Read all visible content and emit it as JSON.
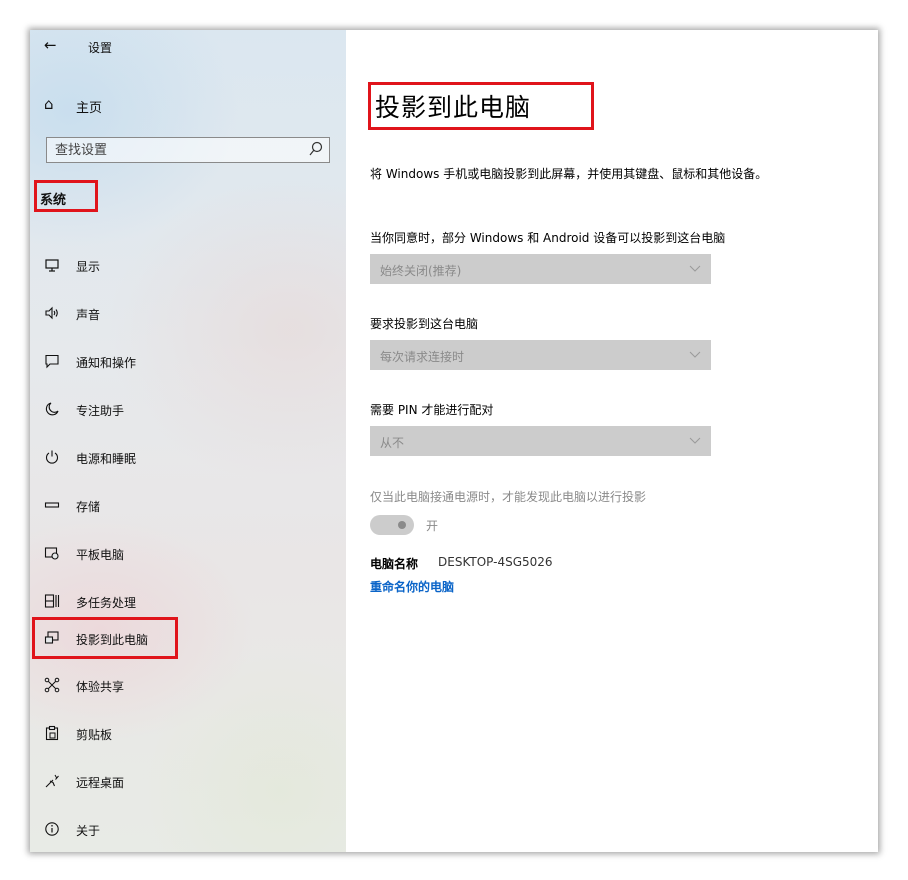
{
  "titlebar": {
    "back_glyph": "←",
    "app_title": "设置"
  },
  "home": {
    "label": "主页"
  },
  "search": {
    "placeholder": "查找设置"
  },
  "section": {
    "title": "系统"
  },
  "nav": [
    {
      "label": "显示",
      "icon": "monitor-icon"
    },
    {
      "label": "声音",
      "icon": "speaker-icon"
    },
    {
      "label": "通知和操作",
      "icon": "notification-icon"
    },
    {
      "label": "专注助手",
      "icon": "moon-icon"
    },
    {
      "label": "电源和睡眠",
      "icon": "power-icon"
    },
    {
      "label": "存储",
      "icon": "storage-icon"
    },
    {
      "label": "平板电脑",
      "icon": "tablet-icon"
    },
    {
      "label": "多任务处理",
      "icon": "multitask-icon"
    },
    {
      "label": "投影到此电脑",
      "icon": "project-icon"
    },
    {
      "label": "体验共享",
      "icon": "share-icon"
    },
    {
      "label": "剪贴板",
      "icon": "clipboard-icon"
    },
    {
      "label": "远程桌面",
      "icon": "remote-desktop-icon"
    },
    {
      "label": "关于",
      "icon": "info-icon"
    }
  ],
  "main": {
    "title": "投影到此电脑",
    "description": "将 Windows 手机或电脑投影到此屏幕，并使用其键盘、鼠标和其他设备。",
    "setting1": {
      "label": "当你同意时，部分 Windows 和 Android 设备可以投影到这台电脑",
      "value": "始终关闭(推荐)"
    },
    "setting2": {
      "label": "要求投影到这台电脑",
      "value": "每次请求连接时"
    },
    "setting3": {
      "label": "需要 PIN 才能进行配对",
      "value": "从不"
    },
    "power_note": "仅当此电脑接通电源时，才能发现此电脑以进行投影",
    "toggle_label": "开",
    "pc_name_label": "电脑名称",
    "pc_name_value": "DESKTOP-4SG5026",
    "rename_link": "重命名你的电脑"
  },
  "colors": {
    "highlight": "#e0141b",
    "link": "#0a64c8",
    "disabled": "#cccccc"
  }
}
